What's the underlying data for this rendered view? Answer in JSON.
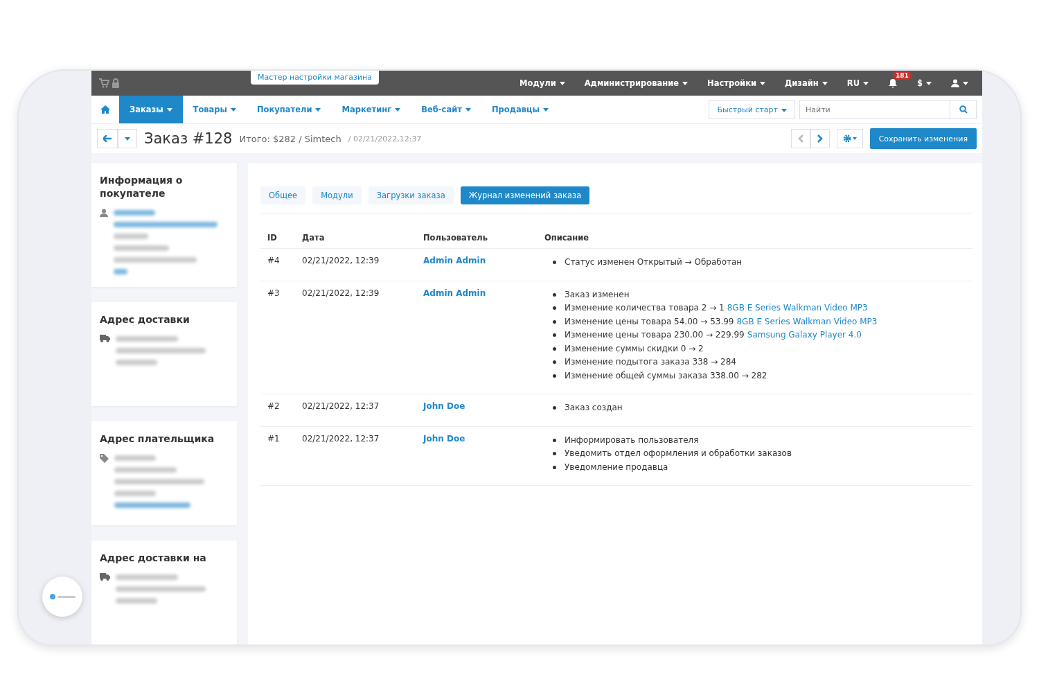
{
  "top_bar": {
    "wizard": "Мастер настройки магазина",
    "menus": [
      {
        "label": "Модули"
      },
      {
        "label": "Администрирование"
      },
      {
        "label": "Настройки"
      },
      {
        "label": "Дизайн"
      },
      {
        "label": "RU"
      }
    ],
    "notifications": "181",
    "currency": "$"
  },
  "nav": {
    "tabs": [
      {
        "label": "Заказы",
        "selected": true
      },
      {
        "label": "Товары",
        "selected": false
      },
      {
        "label": "Покупатели",
        "selected": false
      },
      {
        "label": "Маркетинг",
        "selected": false
      },
      {
        "label": "Веб-сайт",
        "selected": false
      },
      {
        "label": "Продавцы",
        "selected": false
      }
    ],
    "quick_start": "Быстрый старт",
    "search": {
      "placeholder": "Найти"
    }
  },
  "header": {
    "title": "Заказ #128",
    "total": "Итого: $282 / Simtech",
    "date": "/ 02/21/2022,12:37",
    "save": "Сохранить изменения"
  },
  "sidebar": [
    {
      "kind": "customer",
      "title": "Информация о покупателе"
    },
    {
      "kind": "shipping",
      "title": "Адрес доставки"
    },
    {
      "kind": "billing",
      "title": "Адрес плательщика"
    },
    {
      "kind": "shipping",
      "title": "Адрес доставки на"
    }
  ],
  "tabs": [
    {
      "label": "Общее",
      "selected": false
    },
    {
      "label": "Модули",
      "selected": false
    },
    {
      "label": "Загрузки заказа",
      "selected": false
    },
    {
      "label": "Журнал изменений заказа",
      "selected": true
    }
  ],
  "table": {
    "columns": [
      "ID",
      "Дата",
      "Пользователь",
      "Описание"
    ],
    "rows": [
      {
        "id": "#4",
        "date": "02/21/2022, 12:39",
        "user": "Admin Admin",
        "items": [
          {
            "text": "Статус изменен Открытый → Обработан"
          }
        ]
      },
      {
        "id": "#3",
        "date": "02/21/2022, 12:39",
        "user": "Admin Admin",
        "items": [
          {
            "text": "Заказ изменен"
          },
          {
            "text": "Изменение количества товара 2 → 1",
            "link": "8GB E Series Walkman Video MP3"
          },
          {
            "text": "Изменение цены товара 54.00 → 53.99",
            "link": "8GB E Series Walkman Video MP3"
          },
          {
            "text": "Изменение цены товара 230.00 → 229.99",
            "link": "Samsung Galaxy Player 4.0"
          },
          {
            "text": "Изменение суммы скидки 0 → 2"
          },
          {
            "text": "Изменение подытога заказа 338 → 284"
          },
          {
            "text": "Изменение общей суммы заказа 338.00 → 282"
          }
        ]
      },
      {
        "id": "#2",
        "date": "02/21/2022, 12:37",
        "user": "John Doe",
        "items": [
          {
            "text": "Заказ создан"
          }
        ]
      },
      {
        "id": "#1",
        "date": "02/21/2022, 12:37",
        "user": "John Doe",
        "items": [
          {
            "text": "Информировать пользователя"
          },
          {
            "text": "Уведомить отдел оформления и обработки заказов"
          },
          {
            "text": "Уведомление продавца"
          }
        ]
      }
    ]
  }
}
